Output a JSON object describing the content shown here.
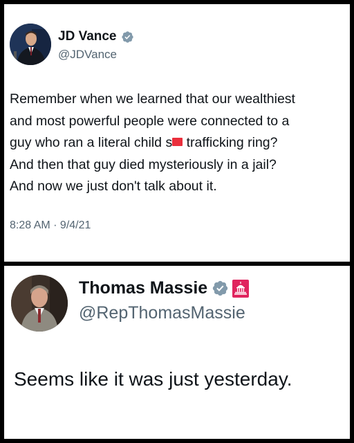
{
  "tweets": [
    {
      "author": {
        "name": "JD Vance",
        "handle": "@JDVance",
        "verified": true
      },
      "body_lines": [
        "Remember when we learned that our wealthiest",
        "and most powerful people were connected to a",
        [
          "guy who ran a literal child s",
          " trafficking ring?"
        ],
        "And then that guy died mysteriously in a jail?",
        "And now we just don't talk about it."
      ],
      "timestamp": "8:28 AM · 9/4/21"
    },
    {
      "author": {
        "name": "Thomas Massie",
        "handle": "@RepThomasMassie",
        "verified": true,
        "government_badge": true
      },
      "body": "Seems like it was just yesterday."
    }
  ],
  "colors": {
    "verified_badge": "#829aab",
    "government_badge": "#e0245e",
    "redaction": "#ea2f3c",
    "secondary_text": "#536471",
    "primary_text": "#0f1419"
  },
  "icons": {
    "verified": "verified-badge-icon",
    "government": "capitol-building-icon"
  }
}
